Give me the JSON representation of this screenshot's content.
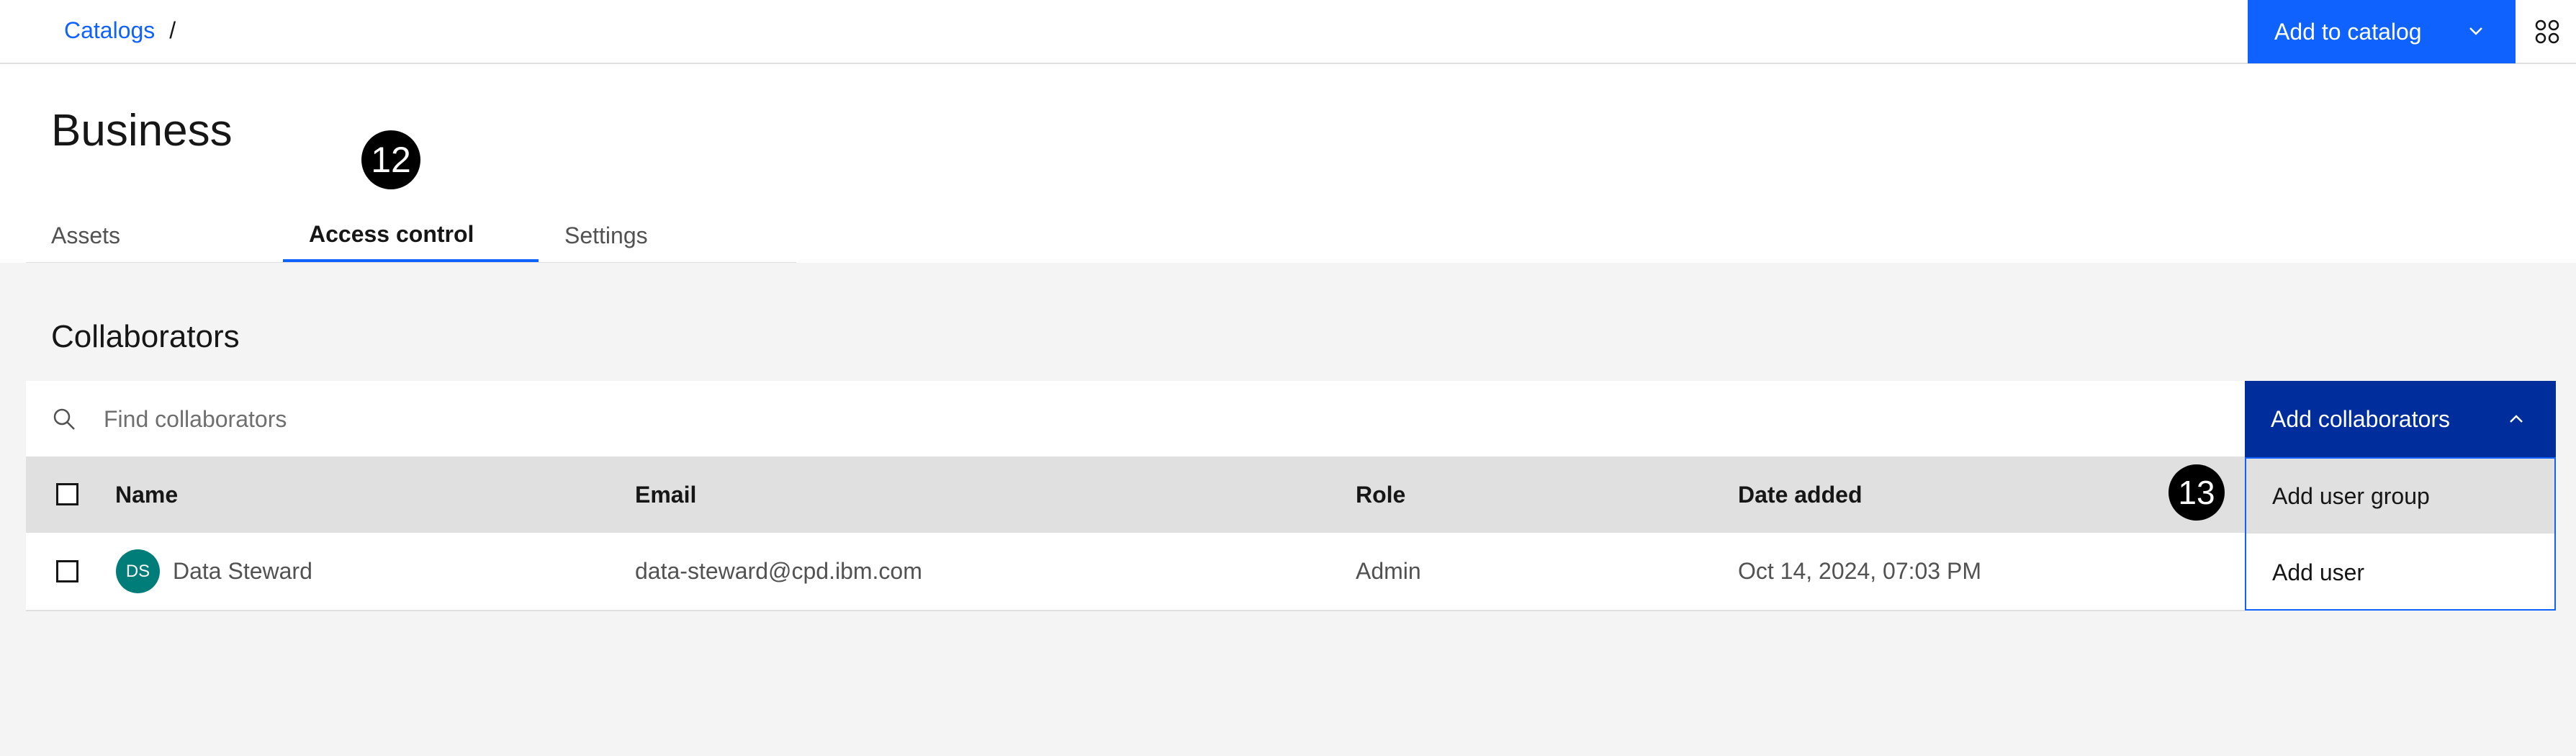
{
  "breadcrumb": {
    "link": "Catalogs",
    "separator": "/"
  },
  "header": {
    "add_to_catalog": "Add to catalog"
  },
  "page": {
    "title": "Business"
  },
  "annotations": {
    "step_tabs": "12",
    "step_dropdown": "13"
  },
  "tabs": [
    {
      "label": "Assets",
      "active": false
    },
    {
      "label": "Access control",
      "active": true
    },
    {
      "label": "Settings",
      "active": false
    }
  ],
  "collaborators": {
    "title": "Collaborators",
    "search_placeholder": "Find collaborators",
    "add_button": "Add collaborators",
    "menu": [
      "Add user group",
      "Add user"
    ],
    "columns": [
      "Name",
      "Email",
      "Role",
      "Date added"
    ],
    "rows": [
      {
        "initials": "DS",
        "name": "Data Steward",
        "email": "data-steward@cpd.ibm.com",
        "role": "Admin",
        "date_added": "Oct 14, 2024, 07:03 PM"
      }
    ]
  },
  "colors": {
    "primary": "#0f62fe",
    "primary_dark": "#002d9c",
    "avatar": "#007d79",
    "background": "#f4f4f4"
  }
}
